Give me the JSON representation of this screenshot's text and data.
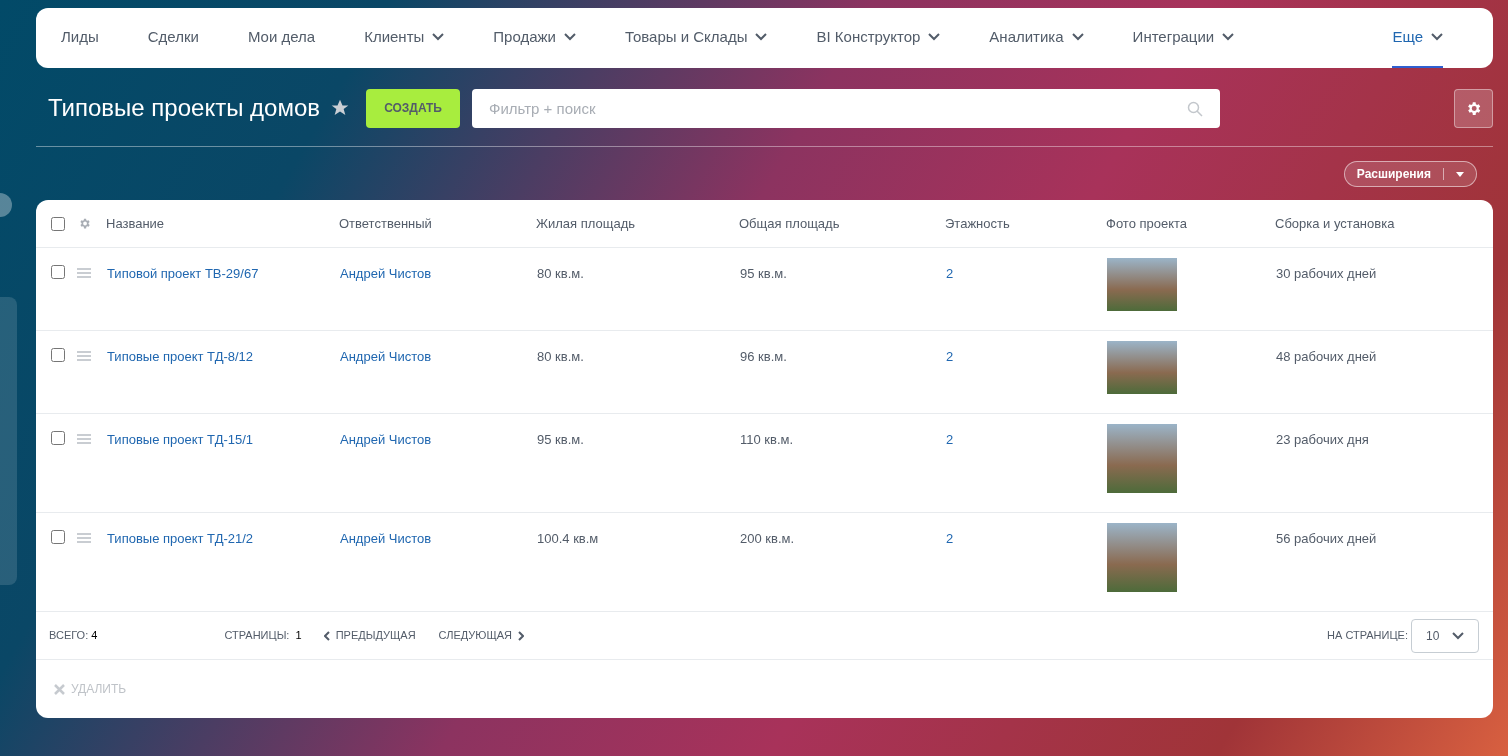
{
  "nav": {
    "items": [
      {
        "label": "Лиды",
        "dropdown": false,
        "selected": false
      },
      {
        "label": "Сделки",
        "dropdown": false,
        "selected": false
      },
      {
        "label": "Мои дела",
        "dropdown": false,
        "selected": false
      },
      {
        "label": "Клиенты",
        "dropdown": true,
        "selected": false
      },
      {
        "label": "Продажи",
        "dropdown": true,
        "selected": false
      },
      {
        "label": "Товары и Склады",
        "dropdown": true,
        "selected": false
      },
      {
        "label": "BI Конструктор",
        "dropdown": true,
        "selected": false
      },
      {
        "label": "Аналитика",
        "dropdown": true,
        "selected": false
      },
      {
        "label": "Интеграции",
        "dropdown": true,
        "selected": false
      },
      {
        "label": "Еще",
        "dropdown": true,
        "selected": true
      }
    ]
  },
  "header": {
    "title": "Типовые проекты домов",
    "create_button": "СОЗДАТЬ",
    "search": {
      "placeholder": "Фильтр + поиск"
    },
    "extensions_button": "Расширения"
  },
  "table": {
    "all_selected": false,
    "columns": [
      "Название",
      "Ответственный",
      "Жилая площадь",
      "Общая площадь",
      "Этажность",
      "Фото проекта",
      "Сборка и установка"
    ],
    "rows": [
      {
        "checked": false,
        "name": "Типовой проект ТВ-29/67",
        "responsible": "Андрей Чистов",
        "living_area": "80 кв.м.",
        "total_area": "95 кв.м.",
        "floors": "2",
        "assembly": "30 рабочих дней"
      },
      {
        "checked": false,
        "name": "Типовые проект ТД-8/12",
        "responsible": "Андрей Чистов",
        "living_area": "80 кв.м.",
        "total_area": "96 кв.м.",
        "floors": "2",
        "assembly": "48 рабочих дней"
      },
      {
        "checked": false,
        "name": "Типовые проект ТД-15/1",
        "responsible": "Андрей Чистов",
        "living_area": "95 кв.м.",
        "total_area": "110 кв.м.",
        "floors": "2",
        "assembly": "23 рабочих дня"
      },
      {
        "checked": false,
        "name": "Типовые проект ТД-21/2",
        "responsible": "Андрей Чистов",
        "living_area": "100.4 кв.м",
        "total_area": "200 кв.м.",
        "floors": "2",
        "assembly": "56 рабочих дней"
      }
    ]
  },
  "footer": {
    "total_label": "ВСЕГО:",
    "total": "4",
    "pages_label": "СТРАНИЦЫ:",
    "page": "1",
    "prev": "ПРЕДЫДУЩАЯ",
    "next": "СЛЕДУЮЩАЯ",
    "per_page_label": "НА СТРАНИЦЕ:",
    "per_page": "10",
    "delete": "УДАЛИТЬ"
  }
}
